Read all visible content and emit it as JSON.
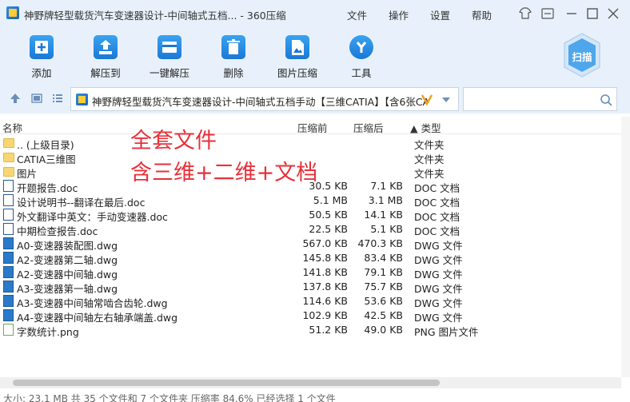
{
  "window": {
    "title": "神野牌轻型载货汽车变速器设计-中间轴式五档... - 360压缩",
    "menu": [
      "文件",
      "操作",
      "设置",
      "帮助"
    ]
  },
  "toolbar": {
    "items": [
      {
        "label": "添加",
        "icon": "add-icon"
      },
      {
        "label": "解压到",
        "icon": "extract-icon"
      },
      {
        "label": "一键解压",
        "icon": "one-click-extract-icon"
      },
      {
        "label": "删除",
        "icon": "delete-icon"
      },
      {
        "label": "图片压缩",
        "icon": "image-compress-icon"
      },
      {
        "label": "工具",
        "icon": "tools-icon"
      }
    ],
    "scan_label": "扫描"
  },
  "address": {
    "path": "神野牌轻型载货汽车变速器设计-中间轴式五档手动【三维CATIA】【含6张CA"
  },
  "columns": {
    "name": "名称",
    "size": "压缩前",
    "csize": "压缩后",
    "type": "▲ 类型"
  },
  "files": [
    {
      "name": ".. (上级目录)",
      "size": "",
      "csize": "",
      "type": "文件夹",
      "kind": "folder"
    },
    {
      "name": "CATIA三维图",
      "size": "",
      "csize": "",
      "type": "文件夹",
      "kind": "folder"
    },
    {
      "name": "图片",
      "size": "",
      "csize": "",
      "type": "文件夹",
      "kind": "folder"
    },
    {
      "name": "开题报告.doc",
      "size": "30.5 KB",
      "csize": "7.1 KB",
      "type": "DOC 文档",
      "kind": "doc"
    },
    {
      "name": "设计说明书--翻译在最后.doc",
      "size": "5.1 MB",
      "csize": "3.1 MB",
      "type": "DOC 文档",
      "kind": "doc"
    },
    {
      "name": "外文翻译中英文：手动变速器.doc",
      "size": "50.5 KB",
      "csize": "14.1 KB",
      "type": "DOC 文档",
      "kind": "doc"
    },
    {
      "name": "中期检查报告.doc",
      "size": "22.5 KB",
      "csize": "5.1 KB",
      "type": "DOC 文档",
      "kind": "doc"
    },
    {
      "name": "A0-变速器装配图.dwg",
      "size": "567.0 KB",
      "csize": "470.3 KB",
      "type": "DWG 文件",
      "kind": "dwg"
    },
    {
      "name": "A2-变速器第二轴.dwg",
      "size": "145.8 KB",
      "csize": "83.4 KB",
      "type": "DWG 文件",
      "kind": "dwg"
    },
    {
      "name": "A2-变速器中间轴.dwg",
      "size": "141.8 KB",
      "csize": "79.1 KB",
      "type": "DWG 文件",
      "kind": "dwg"
    },
    {
      "name": "A3-变速器第一轴.dwg",
      "size": "137.8 KB",
      "csize": "75.7 KB",
      "type": "DWG 文件",
      "kind": "dwg"
    },
    {
      "name": "A3-变速器中间轴常啮合齿轮.dwg",
      "size": "114.6 KB",
      "csize": "53.6 KB",
      "type": "DWG 文件",
      "kind": "dwg"
    },
    {
      "name": "A4-变速器中间轴左右轴承端盖.dwg",
      "size": "102.9 KB",
      "csize": "42.5 KB",
      "type": "DWG 文件",
      "kind": "dwg"
    },
    {
      "name": "字数统计.png",
      "size": "51.2 KB",
      "csize": "49.0 KB",
      "type": "PNG 图片文件",
      "kind": "png"
    }
  ],
  "annotation": {
    "line1": "全套文件",
    "line2": "含三维+二维+文档"
  },
  "status": {
    "text": "大小: 23.1 MB 共 35 个文件和 7 个文件夹 压缩率 84.6% 已经选择 1 个文件"
  },
  "colors": {
    "chrome": "#e8f1fb",
    "accent": "#1a78d6",
    "annotation": "#e8313a"
  }
}
